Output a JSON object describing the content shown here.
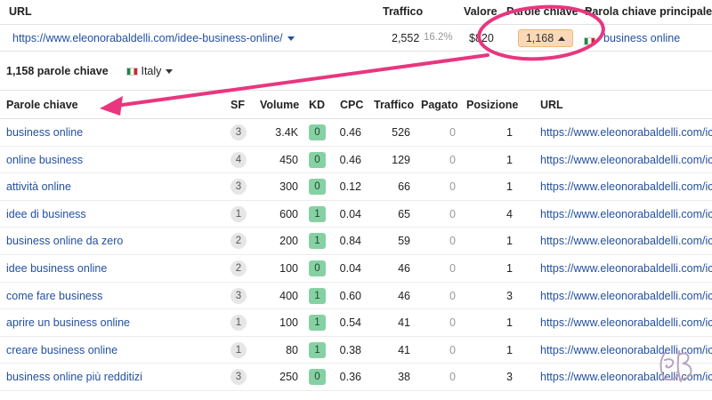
{
  "top_headers": {
    "url": "URL",
    "traffic": "Traffico",
    "value": "Valore",
    "keywords": "Parole chiave",
    "main_keyword": "Parola chiave principale"
  },
  "top_row": {
    "url": "https://www.eleonorabaldelli.com/idee-business-online/",
    "traffic": "2,552",
    "traffic_pct": "16.2%",
    "value": "$820",
    "keywords": "1,168",
    "main_keyword": "business online"
  },
  "subbar": {
    "count_label": "1,158 parole chiave",
    "country": "Italy"
  },
  "columns": {
    "keyword": "Parole chiave",
    "sf": "SF",
    "volume": "Volume",
    "kd": "KD",
    "cpc": "CPC",
    "traffic": "Traffico",
    "paid": "Pagato",
    "position": "Posizione",
    "url": "URL"
  },
  "rows": [
    {
      "keyword": "business online",
      "sf": "3",
      "volume": "3.4K",
      "kd": "0",
      "cpc": "0.46",
      "traffic": "526",
      "paid": "0",
      "position": "1",
      "url": "https://www.eleonorabaldelli.com/ic"
    },
    {
      "keyword": "online business",
      "sf": "4",
      "volume": "450",
      "kd": "0",
      "cpc": "0.46",
      "traffic": "129",
      "paid": "0",
      "position": "1",
      "url": "https://www.eleonorabaldelli.com/ic"
    },
    {
      "keyword": "attività online",
      "sf": "3",
      "volume": "300",
      "kd": "0",
      "cpc": "0.12",
      "traffic": "66",
      "paid": "0",
      "position": "1",
      "url": "https://www.eleonorabaldelli.com/ic"
    },
    {
      "keyword": "idee di business",
      "sf": "1",
      "volume": "600",
      "kd": "1",
      "cpc": "0.04",
      "traffic": "65",
      "paid": "0",
      "position": "4",
      "url": "https://www.eleonorabaldelli.com/ic"
    },
    {
      "keyword": "business online da zero",
      "sf": "2",
      "volume": "200",
      "kd": "1",
      "cpc": "0.84",
      "traffic": "59",
      "paid": "0",
      "position": "1",
      "url": "https://www.eleonorabaldelli.com/ic"
    },
    {
      "keyword": "idee business online",
      "sf": "2",
      "volume": "100",
      "kd": "0",
      "cpc": "0.04",
      "traffic": "46",
      "paid": "0",
      "position": "1",
      "url": "https://www.eleonorabaldelli.com/ic"
    },
    {
      "keyword": "come fare business",
      "sf": "3",
      "volume": "400",
      "kd": "1",
      "cpc": "0.60",
      "traffic": "46",
      "paid": "0",
      "position": "3",
      "url": "https://www.eleonorabaldelli.com/ic"
    },
    {
      "keyword": "aprire un business online",
      "sf": "1",
      "volume": "100",
      "kd": "1",
      "cpc": "0.54",
      "traffic": "41",
      "paid": "0",
      "position": "1",
      "url": "https://www.eleonorabaldelli.com/ic"
    },
    {
      "keyword": "creare business online",
      "sf": "1",
      "volume": "80",
      "kd": "1",
      "cpc": "0.38",
      "traffic": "41",
      "paid": "0",
      "position": "1",
      "url": "https://www.eleonorabaldelli.com/ic"
    },
    {
      "keyword": "business online più redditizi",
      "sf": "3",
      "volume": "250",
      "kd": "0",
      "cpc": "0.36",
      "traffic": "38",
      "paid": "0",
      "position": "3",
      "url": "https://www.eleonorabaldelli.com/ic"
    }
  ],
  "colors": {
    "link": "#2350a0",
    "kd_badge": "#86d1a4",
    "highlight_pill": "#fbd9b6",
    "annotation": "#e8367f"
  },
  "signature_mark": "EB"
}
